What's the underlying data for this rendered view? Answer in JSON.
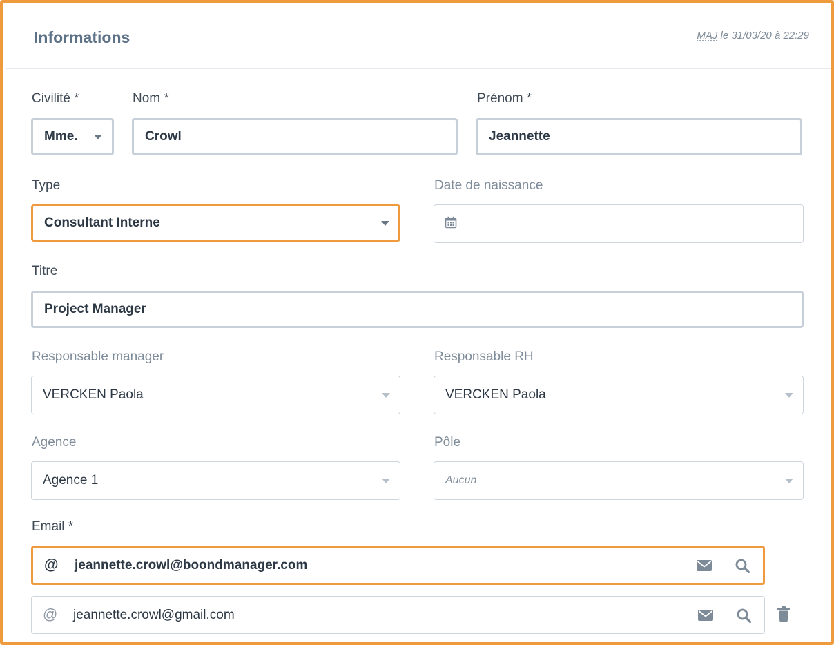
{
  "header": {
    "title": "Informations",
    "updated_abbr": "MAJ",
    "updated_rest": " le 31/03/20 à 22:29"
  },
  "form": {
    "civilite": {
      "label": "Civilité *",
      "value": "Mme."
    },
    "nom": {
      "label": "Nom *",
      "value": "Crowl"
    },
    "prenom": {
      "label": "Prénom *",
      "value": "Jeannette"
    },
    "type": {
      "label": "Type",
      "value": "Consultant Interne"
    },
    "date_naissance": {
      "label": "Date de naissance",
      "value": ""
    },
    "titre": {
      "label": "Titre",
      "value": "Project Manager"
    },
    "responsable_manager": {
      "label": "Responsable manager",
      "value": "VERCKEN Paola"
    },
    "responsable_rh": {
      "label": "Responsable RH",
      "value": "VERCKEN Paola"
    },
    "agence": {
      "label": "Agence",
      "value": "Agence 1"
    },
    "pole": {
      "label": "Pôle",
      "placeholder": "Aucun"
    },
    "email": {
      "label": "Email *",
      "at_symbol": "@",
      "entries": [
        {
          "value": "jeannette.crowl@boondmanager.com"
        },
        {
          "value": "jeannette.crowl@gmail.com"
        }
      ]
    }
  },
  "colors": {
    "focus_border": "#ef9a3c",
    "title": "#5d7187",
    "icon": "#7d8a97"
  },
  "icons": [
    "calendar-icon",
    "mail-icon",
    "search-icon",
    "trash-icon",
    "caret-down-icon"
  ]
}
